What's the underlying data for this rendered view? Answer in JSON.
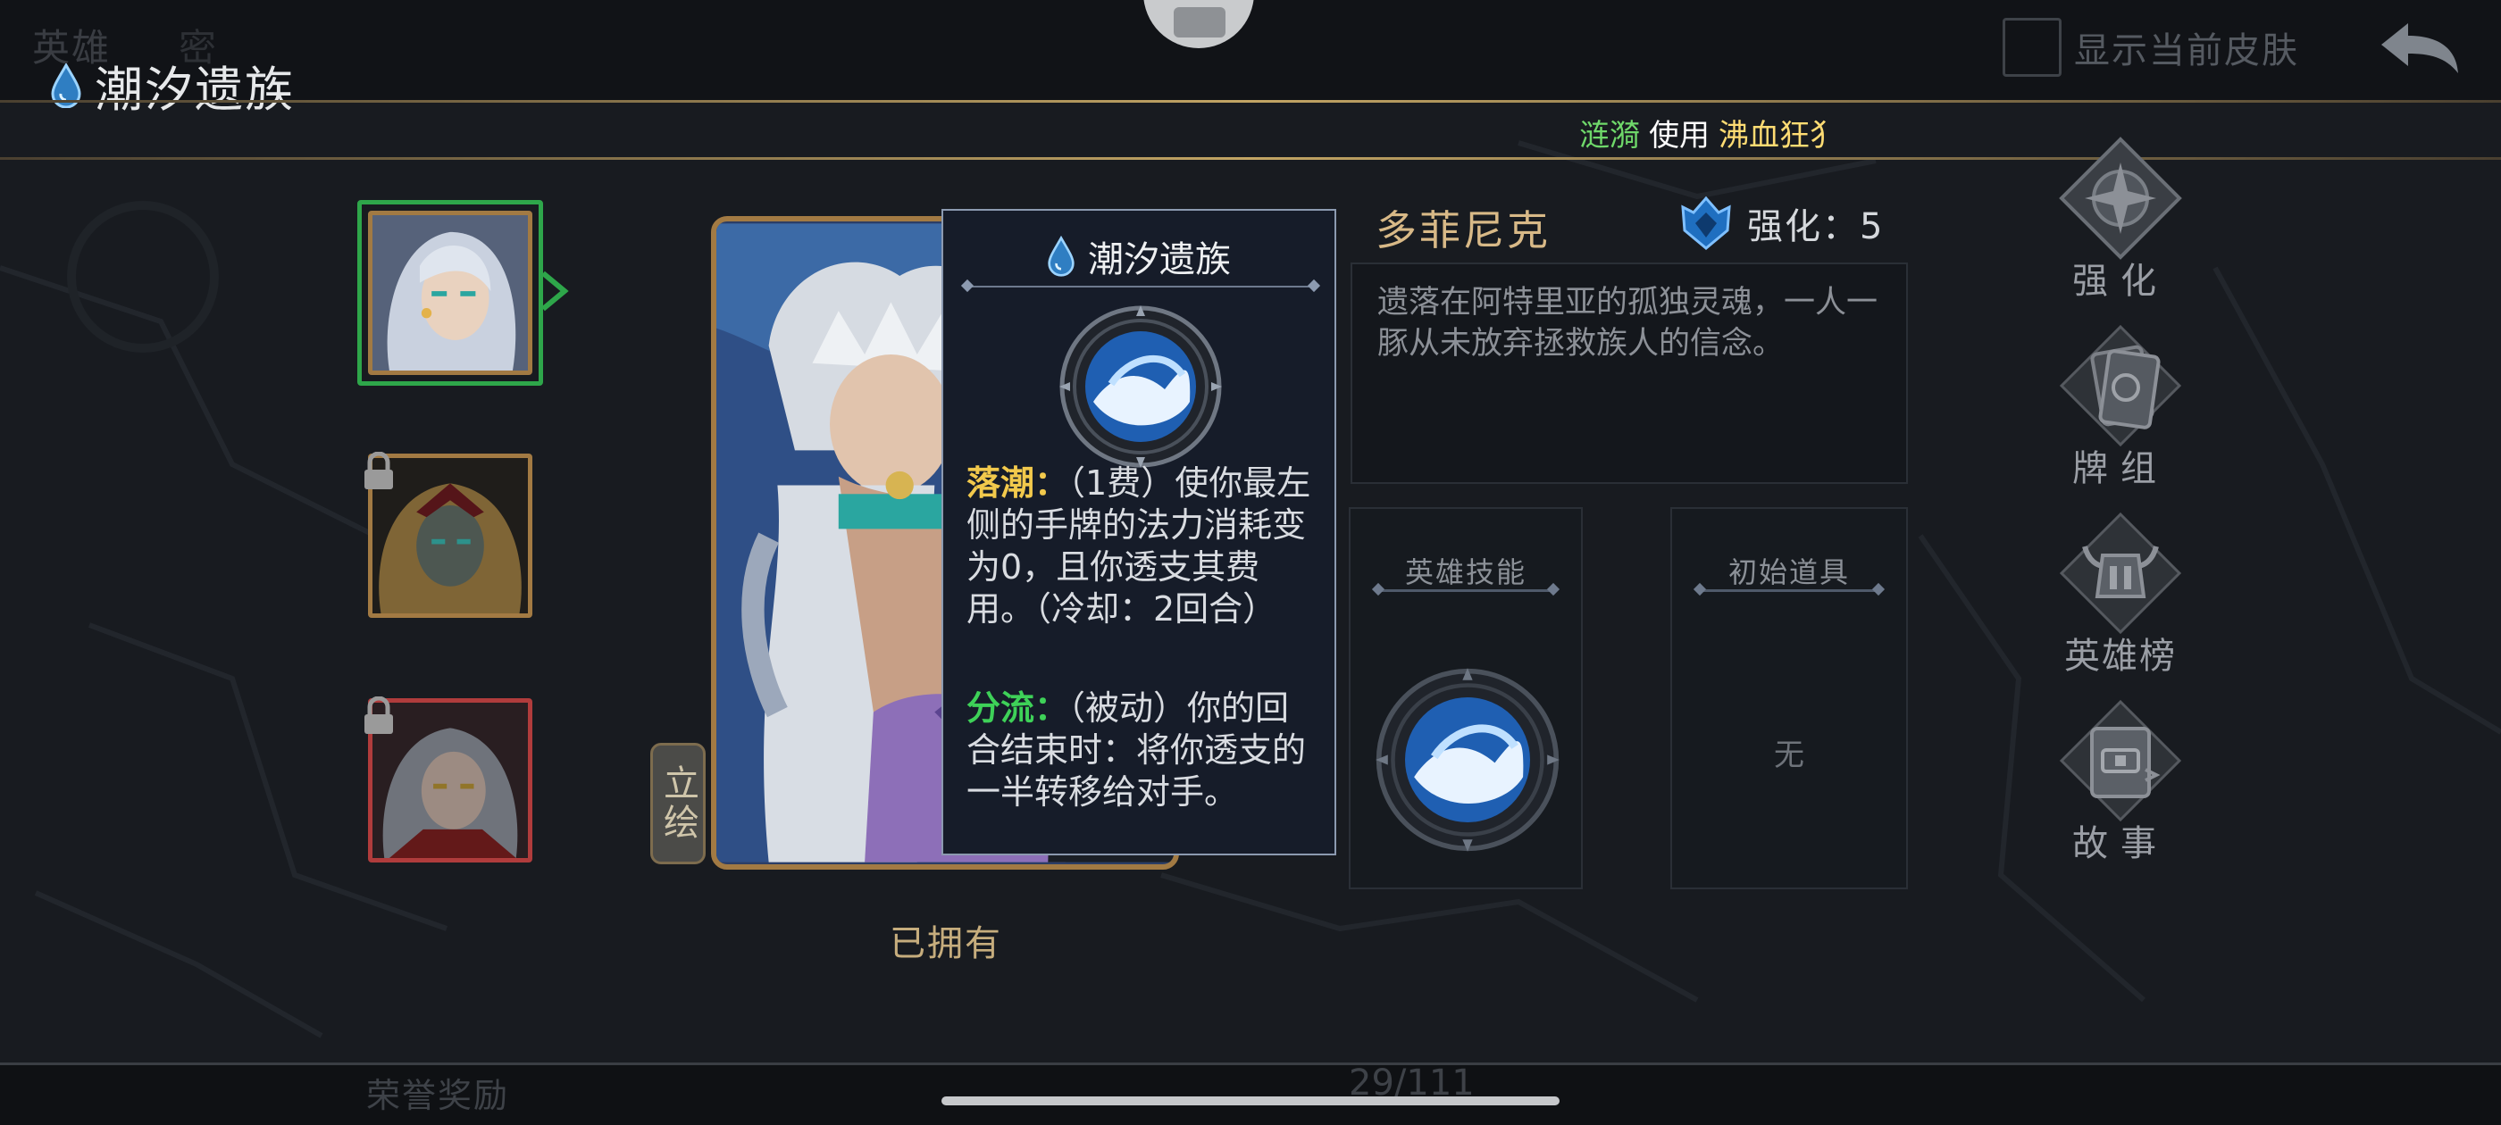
{
  "header": {
    "faded_tab_1": "英雄",
    "faded_tab_2": "密",
    "faction_title": "潮汐遗族",
    "skin_toggle_label": "显示当前皮肤"
  },
  "ticker": {
    "player": "涟漪",
    "verb": "使用",
    "subject": "沸血狂犭"
  },
  "heroes": [
    {
      "name": "selected-hero",
      "selected": true,
      "locked": false
    },
    {
      "name": "hero-2",
      "selected": false,
      "locked": true
    },
    {
      "name": "hero-3",
      "selected": false,
      "locked": true
    }
  ],
  "card": {
    "art_tab_label": "立绘",
    "owned_label": "已拥有"
  },
  "tooltip": {
    "title": "潮汐遗族",
    "skill1_name": "落潮：",
    "skill1_text": "（1费）使你最左侧的手牌的法力消耗变为0，且你透支其费用。（冷却：2回合）",
    "skill2_name": "分流：",
    "skill2_text": "（被动）你的回合结束时：将你透支的一半转移给对手。"
  },
  "hero_info": {
    "name": "多菲尼克",
    "enhance_label": "强化：5",
    "description": "遗落在阿特里亚的孤独灵魂，一人一豚从未放弃拯救族人的信念。",
    "hero_skill_label": "英雄技能",
    "starting_item_label": "初始道具",
    "starting_item_value": "无"
  },
  "menu": {
    "enhance": "强化",
    "deck": "牌组",
    "leaderboard": "英雄榜",
    "story": "故事"
  },
  "footer": {
    "faded_label": "荣誉奖励",
    "count": "29/111"
  },
  "colors": {
    "gold": "#c2a564",
    "selected_border": "#2ea64a",
    "locked_red": "#b03c3c",
    "keyword_yellow": "#f2c94c",
    "keyword_green": "#3ed158"
  }
}
